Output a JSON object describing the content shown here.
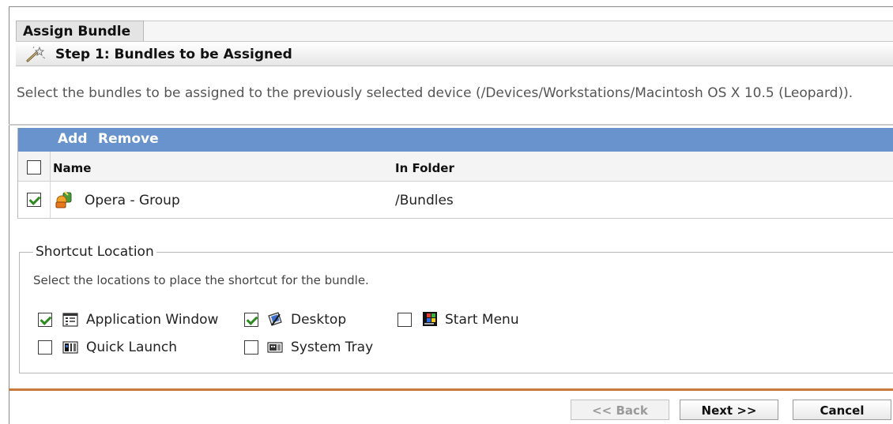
{
  "header": {
    "tab_label": "Assign Bundle",
    "step_title": "Step 1: Bundles to be Assigned"
  },
  "description": "Select the bundles to be assigned to the previously selected device (/Devices/Workstations/Macintosh OS X 10.5 (Leopard)).",
  "bundle_table": {
    "actions": {
      "add_label": "Add",
      "remove_label": "Remove"
    },
    "columns": {
      "name": "Name",
      "folder": "In Folder"
    },
    "select_all_checked": false,
    "rows": [
      {
        "name": "Opera - Group",
        "folder": "/Bundles",
        "checked": true,
        "icon": "bundle-group-icon"
      }
    ]
  },
  "shortcut_location": {
    "legend": "Shortcut Location",
    "hint": "Select the locations to place the shortcut for the bundle.",
    "options": [
      {
        "label": "Application Window",
        "checked": true,
        "icon": "application-window-icon"
      },
      {
        "label": "Desktop",
        "checked": true,
        "icon": "desktop-icon"
      },
      {
        "label": "Start Menu",
        "checked": false,
        "icon": "start-menu-icon"
      },
      {
        "label": "Quick Launch",
        "checked": false,
        "icon": "quick-launch-icon"
      },
      {
        "label": "System Tray",
        "checked": false,
        "icon": "system-tray-icon"
      }
    ]
  },
  "footer": {
    "back_label": "<< Back",
    "back_enabled": false,
    "next_label": "Next >>",
    "cancel_label": "Cancel"
  },
  "colors": {
    "action_bar": "#6993cc",
    "footer_rule": "#c77a3e",
    "checkmark": "#2d8a1f"
  }
}
